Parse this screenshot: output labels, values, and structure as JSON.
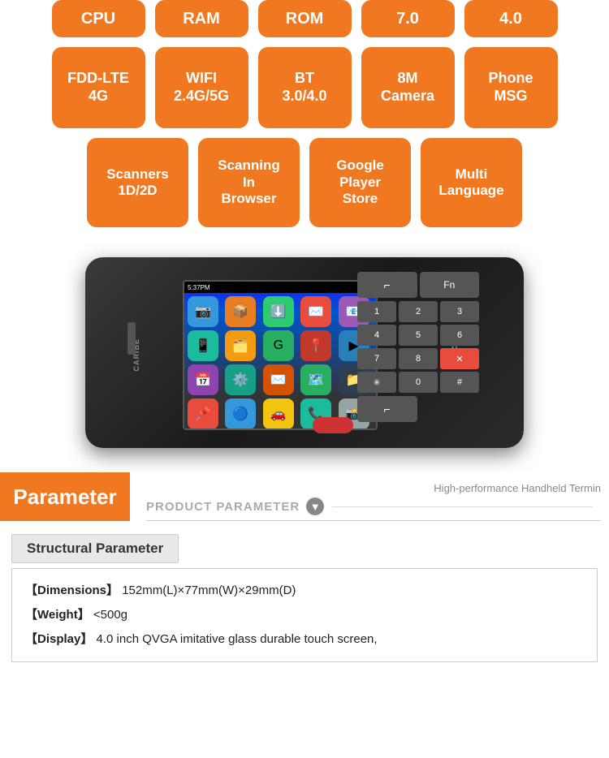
{
  "badges_row1": [
    {
      "id": "cpu",
      "label": "CPU"
    },
    {
      "id": "ram",
      "label": "RAM"
    },
    {
      "id": "rom",
      "label": "ROM"
    },
    {
      "id": "android",
      "label": "7.0"
    },
    {
      "id": "version",
      "label": "4.0"
    }
  ],
  "badges_row2": [
    {
      "id": "fdd-lte",
      "label": "FDD-LTE\n4G"
    },
    {
      "id": "wifi",
      "label": "WIFI\n2.4G/5G"
    },
    {
      "id": "bt",
      "label": "BT\n3.0/4.0"
    },
    {
      "id": "camera",
      "label": "8M\nCamera"
    },
    {
      "id": "phone",
      "label": "Phone\nMSG"
    }
  ],
  "badges_row3": [
    {
      "id": "scanners",
      "label": "Scanners\n1D/2D"
    },
    {
      "id": "scanning",
      "label": "Scanning\nIn\nBrowser"
    },
    {
      "id": "google",
      "label": "Google\nPlayer\nStore"
    },
    {
      "id": "multilang",
      "label": "Multi\nLanguage"
    }
  ],
  "parameter": {
    "label": "Parameter",
    "subtitle": "High-performance Handheld Termin",
    "product_param": "PRODUCT PARAMETER"
  },
  "structural": {
    "header": "Structural Parameter",
    "params": [
      {
        "key": "【Dimensions】",
        "value": "152mm(L)×77mm(W)×29mm(D)"
      },
      {
        "key": "【Weight】",
        "value": "<500g"
      },
      {
        "key": "【Display】",
        "value": "4.0 inch QVGA imitative glass durable touch screen,"
      }
    ]
  },
  "device": {
    "brand": "CARIBE",
    "screen_time": "5:37PM"
  }
}
